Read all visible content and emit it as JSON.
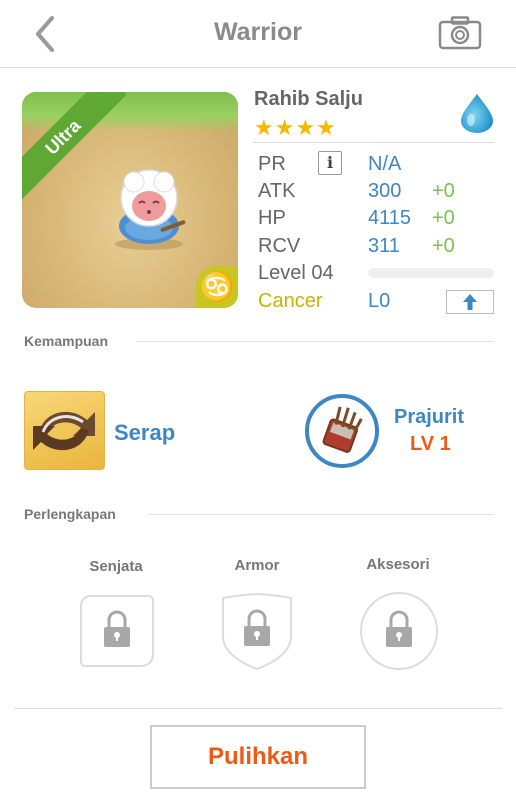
{
  "header": {
    "title": "Warrior"
  },
  "character": {
    "name": "Rahib Salju",
    "stars": "★★★★",
    "rarity_badge": "Ultra",
    "sign_glyph": "♋",
    "element_icon": "water-drop-icon",
    "stats": {
      "pr": {
        "label": "PR",
        "value": "N/A"
      },
      "atk": {
        "label": "ATK",
        "value": "300",
        "bonus": "+0"
      },
      "hp": {
        "label": "HP",
        "value": "4115",
        "bonus": "+0"
      },
      "rcv": {
        "label": "RCV",
        "value": "311",
        "bonus": "+0"
      },
      "level": {
        "label": "Level 04",
        "progress": 0
      },
      "zodiac": {
        "label": "Cancer",
        "value": "L0"
      }
    }
  },
  "abilities": {
    "heading": "Kemampuan",
    "skill": {
      "name": "Serap"
    },
    "class": {
      "name": "Prajurit",
      "level": "LV 1"
    }
  },
  "equipment": {
    "heading": "Perlengkapan",
    "slots": [
      {
        "label": "Senjata"
      },
      {
        "label": "Armor"
      },
      {
        "label": "Aksesori"
      }
    ]
  },
  "footer": {
    "restore_label": "Pulihkan"
  },
  "colors": {
    "accent_blue": "#3f86c5",
    "bonus_green": "#77c44a",
    "orange": "#ee5a16",
    "star_gold": "#f5b800"
  }
}
